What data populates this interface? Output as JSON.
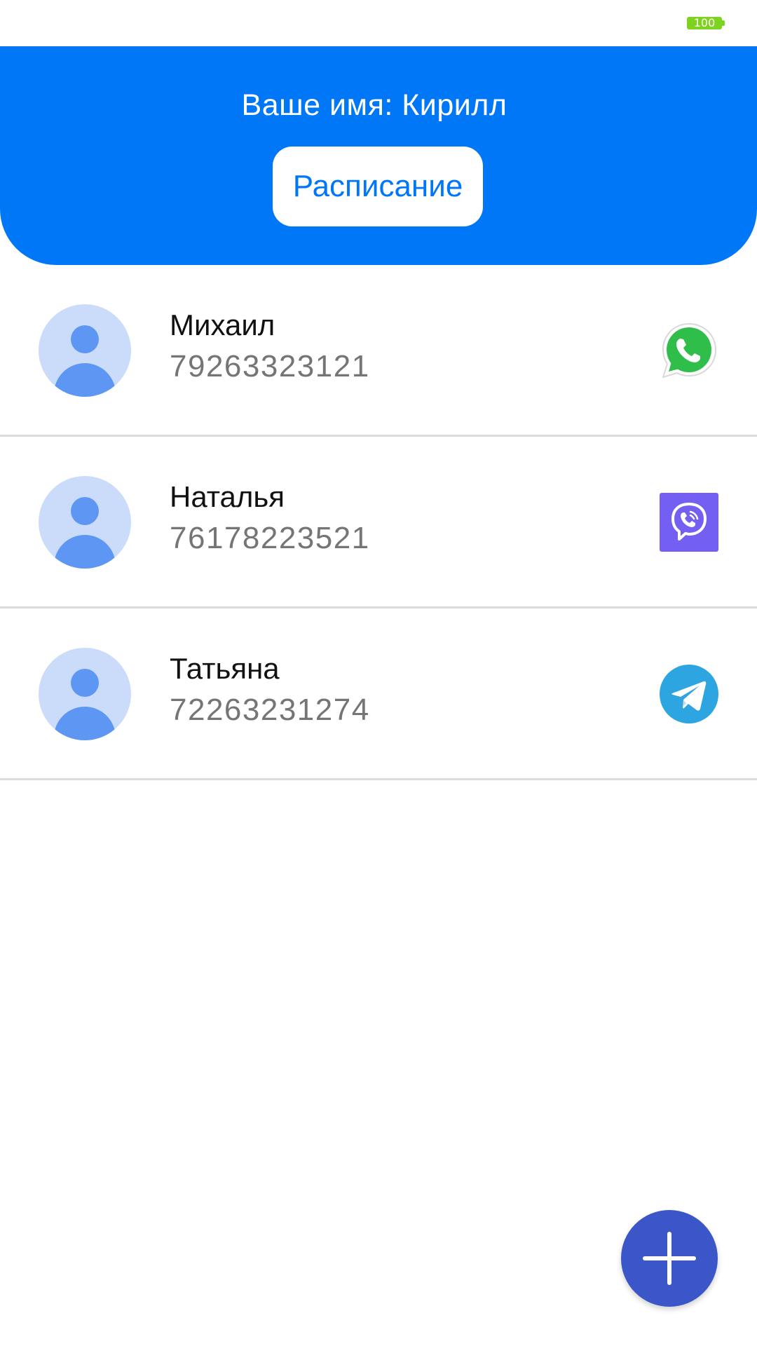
{
  "status_bar": {
    "battery_level": "100",
    "battery_color": "#7ed321"
  },
  "header": {
    "greeting": "Ваше имя: Кирилл",
    "schedule_button_label": "Расписание",
    "background_color": "#0077f7"
  },
  "contacts": [
    {
      "name": "Михаил",
      "phone": "79263323121",
      "messenger_icon": "whatsapp-icon"
    },
    {
      "name": "Наталья",
      "phone": "76178223521",
      "messenger_icon": "viber-icon"
    },
    {
      "name": "Татьяна",
      "phone": "72263231274",
      "messenger_icon": "telegram-icon"
    }
  ],
  "fab": {
    "icon": "plus-icon",
    "color": "#3b56c9"
  }
}
